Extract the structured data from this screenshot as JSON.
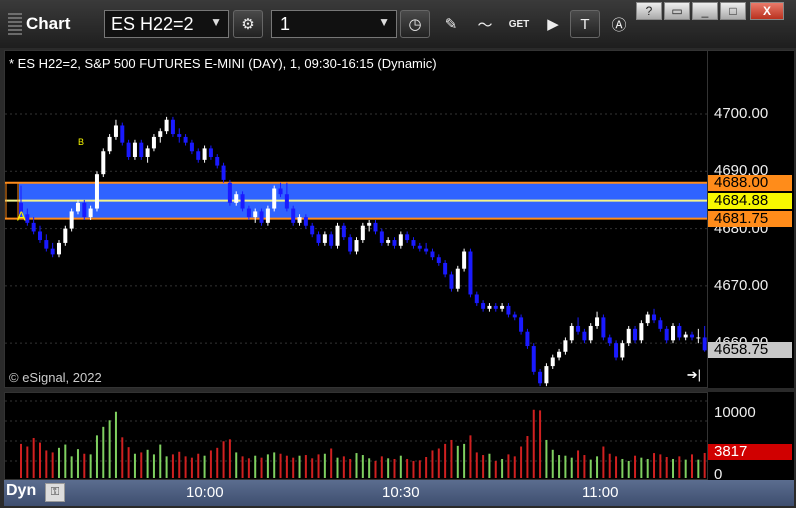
{
  "toolbar": {
    "app_title": "Chart",
    "symbol": "ES H22=2",
    "interval": "1",
    "get_label": "GET"
  },
  "window_buttons": [
    "?",
    "",
    "",
    "X"
  ],
  "chart": {
    "caption": "* ES H22=2, S&P 500 FUTURES E-MINI (DAY), 1, 09:30-16:15 (Dynamic)",
    "copyright": "© eSignal, 2022",
    "marker_a": "A",
    "marker_b": "B",
    "price_ticks": [
      "4700.00",
      "4690.00",
      "4680.00",
      "4670.00",
      "4660.00"
    ],
    "price_labels": {
      "upper": "4688.00",
      "mid": "4684.88",
      "lower": "4681.75",
      "last": "4658.75"
    },
    "volume_ticks": [
      "10000",
      "0"
    ],
    "volume_label": "3817",
    "time_labels": [
      "10:00",
      "10:30",
      "11:00"
    ],
    "dyn_label": "Dyn",
    "colors": {
      "up": "#ffffff",
      "down": "#1a1aff",
      "band": "#2f63ff",
      "band_edge": "#ff8c1a",
      "mid_line": "#f4f48a",
      "vol_up": "#7fd060",
      "vol_down": "#d02020"
    }
  },
  "chart_data": {
    "type": "candlestick",
    "bars": [
      [
        4684.5,
        4687.5,
        4682.0,
        4682.5
      ],
      [
        4682.5,
        4683.5,
        4680.5,
        4681.0
      ],
      [
        4681.0,
        4682.0,
        4679.0,
        4679.5
      ],
      [
        4679.5,
        4680.5,
        4677.5,
        4678.0
      ],
      [
        4678.0,
        4679.0,
        4676.0,
        4676.5
      ],
      [
        4676.5,
        4677.5,
        4675.0,
        4675.5
      ],
      [
        4675.5,
        4678.0,
        4675.0,
        4677.5
      ],
      [
        4677.5,
        4680.5,
        4677.0,
        4680.0
      ],
      [
        4680.0,
        4683.5,
        4679.5,
        4683.0
      ],
      [
        4683.0,
        4685.0,
        4682.5,
        4684.5
      ],
      [
        4684.5,
        4685.0,
        4681.5,
        4682.0
      ],
      [
        4682.0,
        4684.0,
        4681.5,
        4683.5
      ],
      [
        4683.5,
        4690.0,
        4683.0,
        4689.5
      ],
      [
        4689.5,
        4694.0,
        4689.0,
        4693.5
      ],
      [
        4693.5,
        4696.5,
        4693.0,
        4696.0
      ],
      [
        4696.0,
        4699.0,
        4695.5,
        4698.0
      ],
      [
        4698.0,
        4698.5,
        4694.5,
        4695.0
      ],
      [
        4695.0,
        4695.5,
        4692.0,
        4692.5
      ],
      [
        4692.5,
        4695.5,
        4692.0,
        4695.0
      ],
      [
        4695.0,
        4695.5,
        4692.0,
        4692.5
      ],
      [
        4692.5,
        4694.5,
        4691.5,
        4694.0
      ],
      [
        4694.0,
        4696.5,
        4693.5,
        4696.0
      ],
      [
        4696.0,
        4697.5,
        4695.0,
        4697.0
      ],
      [
        4697.0,
        4699.5,
        4696.5,
        4699.0
      ],
      [
        4699.0,
        4699.5,
        4696.0,
        4696.5
      ],
      [
        4696.5,
        4697.5,
        4695.0,
        4696.0
      ],
      [
        4696.0,
        4696.5,
        4694.5,
        4695.0
      ],
      [
        4695.0,
        4695.5,
        4693.0,
        4693.5
      ],
      [
        4693.5,
        4694.0,
        4691.5,
        4692.0
      ],
      [
        4692.0,
        4694.5,
        4691.5,
        4694.0
      ],
      [
        4694.0,
        4694.5,
        4692.0,
        4692.5
      ],
      [
        4692.5,
        4693.0,
        4690.5,
        4691.0
      ],
      [
        4691.0,
        4691.5,
        4688.0,
        4688.5
      ],
      [
        4688.0,
        4688.5,
        4684.0,
        4684.5
      ],
      [
        4684.5,
        4686.5,
        4684.0,
        4686.0
      ],
      [
        4686.0,
        4686.5,
        4683.0,
        4683.5
      ],
      [
        4683.5,
        4684.0,
        4681.5,
        4682.0
      ],
      [
        4682.0,
        4683.5,
        4681.0,
        4683.0
      ],
      [
        4683.0,
        4683.5,
        4680.5,
        4681.0
      ],
      [
        4681.0,
        4684.0,
        4680.5,
        4683.5
      ],
      [
        4683.5,
        4687.5,
        4683.0,
        4687.0
      ],
      [
        4687.0,
        4688.0,
        4685.5,
        4686.0
      ],
      [
        4686.0,
        4688.0,
        4683.0,
        4683.5
      ],
      [
        4683.5,
        4684.0,
        4680.5,
        4681.0
      ],
      [
        4681.0,
        4682.5,
        4680.5,
        4682.0
      ],
      [
        4682.0,
        4682.5,
        4680.0,
        4680.5
      ],
      [
        4680.5,
        4681.0,
        4678.5,
        4679.0
      ],
      [
        4679.0,
        4679.5,
        4677.0,
        4677.5
      ],
      [
        4677.5,
        4679.5,
        4677.0,
        4679.0
      ],
      [
        4679.0,
        4679.5,
        4676.5,
        4677.0
      ],
      [
        4677.0,
        4681.0,
        4676.5,
        4680.5
      ],
      [
        4680.5,
        4681.0,
        4678.0,
        4678.5
      ],
      [
        4678.5,
        4679.0,
        4675.5,
        4676.0
      ],
      [
        4676.0,
        4678.5,
        4675.5,
        4678.0
      ],
      [
        4678.0,
        4681.0,
        4677.5,
        4680.5
      ],
      [
        4680.5,
        4681.5,
        4679.5,
        4681.0
      ],
      [
        4681.0,
        4681.5,
        4679.0,
        4679.5
      ],
      [
        4679.5,
        4680.0,
        4677.0,
        4677.5
      ],
      [
        4677.5,
        4678.5,
        4677.0,
        4678.0
      ],
      [
        4678.0,
        4678.5,
        4676.5,
        4677.0
      ],
      [
        4677.0,
        4679.5,
        4676.5,
        4679.0
      ],
      [
        4679.0,
        4679.5,
        4677.5,
        4678.0
      ],
      [
        4678.0,
        4678.5,
        4676.5,
        4677.0
      ],
      [
        4677.0,
        4677.5,
        4676.0,
        4676.5
      ],
      [
        4676.5,
        4677.5,
        4675.5,
        4676.0
      ],
      [
        4676.0,
        4676.5,
        4674.5,
        4675.0
      ],
      [
        4675.0,
        4675.5,
        4673.5,
        4674.0
      ],
      [
        4674.0,
        4674.5,
        4671.5,
        4672.0
      ],
      [
        4672.0,
        4672.5,
        4669.0,
        4669.5
      ],
      [
        4669.5,
        4673.5,
        4669.0,
        4673.0
      ],
      [
        4673.0,
        4676.5,
        4672.5,
        4676.0
      ],
      [
        4676.0,
        4676.5,
        4668.0,
        4668.5
      ],
      [
        4668.5,
        4669.0,
        4666.5,
        4667.0
      ],
      [
        4667.0,
        4667.5,
        4665.5,
        4666.0
      ],
      [
        4666.0,
        4667.0,
        4665.5,
        4666.5
      ],
      [
        4666.5,
        4667.0,
        4665.5,
        4666.0
      ],
      [
        4666.0,
        4667.0,
        4665.5,
        4666.5
      ],
      [
        4666.5,
        4667.0,
        4664.5,
        4665.0
      ],
      [
        4665.0,
        4665.5,
        4664.0,
        4664.5
      ],
      [
        4664.5,
        4665.0,
        4661.5,
        4662.0
      ],
      [
        4662.0,
        4662.5,
        4659.0,
        4659.5
      ],
      [
        4659.5,
        4660.0,
        4654.5,
        4655.0
      ],
      [
        4655.0,
        4655.5,
        4652.5,
        4653.0
      ],
      [
        4653.0,
        4656.5,
        4652.5,
        4656.0
      ],
      [
        4656.0,
        4658.0,
        4655.5,
        4657.5
      ],
      [
        4657.5,
        4659.0,
        4657.0,
        4658.5
      ],
      [
        4658.5,
        4661.0,
        4658.0,
        4660.5
      ],
      [
        4660.5,
        4663.5,
        4660.0,
        4663.0
      ],
      [
        4663.0,
        4664.5,
        4661.5,
        4662.0
      ],
      [
        4662.0,
        4662.5,
        4660.0,
        4660.5
      ],
      [
        4660.5,
        4663.5,
        4660.0,
        4663.0
      ],
      [
        4663.0,
        4665.5,
        4662.5,
        4664.5
      ],
      [
        4664.5,
        4665.0,
        4660.5,
        4661.0
      ],
      [
        4661.0,
        4661.5,
        4659.5,
        4660.0
      ],
      [
        4660.0,
        4660.5,
        4657.0,
        4657.5
      ],
      [
        4657.5,
        4660.5,
        4657.0,
        4660.0
      ],
      [
        4660.0,
        4663.0,
        4659.5,
        4662.5
      ],
      [
        4662.5,
        4663.0,
        4660.0,
        4660.5
      ],
      [
        4660.5,
        4664.0,
        4660.0,
        4663.5
      ],
      [
        4663.5,
        4665.5,
        4663.0,
        4665.0
      ],
      [
        4665.0,
        4666.0,
        4663.5,
        4664.0
      ],
      [
        4664.0,
        4664.5,
        4662.0,
        4662.5
      ],
      [
        4662.5,
        4663.0,
        4660.0,
        4660.5
      ],
      [
        4660.5,
        4663.5,
        4660.0,
        4663.0
      ],
      [
        4663.0,
        4663.5,
        4660.5,
        4661.0
      ],
      [
        4661.0,
        4662.0,
        4660.5,
        4661.5
      ],
      [
        4661.5,
        4662.0,
        4660.5,
        4661.0
      ],
      [
        4661.0,
        4662.5,
        4660.0,
        4661.0
      ],
      [
        4661.0,
        4663.0,
        4658.5,
        4658.75
      ]
    ],
    "volume": [
      5200,
      4800,
      6100,
      5400,
      4200,
      3900,
      4600,
      5100,
      3300,
      4400,
      3700,
      3600,
      6500,
      7800,
      8800,
      10100,
      6200,
      4700,
      3700,
      3900,
      4300,
      3600,
      5100,
      3300,
      3600,
      4000,
      3300,
      3100,
      3700,
      3400,
      4200,
      4600,
      5600,
      5900,
      3900,
      3300,
      3000,
      3400,
      3100,
      3600,
      3900,
      3700,
      3400,
      3100,
      3400,
      3500,
      3000,
      3600,
      3700,
      4500,
      3100,
      3300,
      2900,
      3800,
      3500,
      3000,
      2600,
      3300,
      3000,
      2900,
      3400,
      2900,
      2600,
      2700,
      3200,
      4200,
      4500,
      5200,
      5800,
      4900,
      5200,
      6500,
      3900,
      3500,
      3700,
      2600,
      2900,
      3600,
      3300,
      4800,
      6400,
      10400,
      10300,
      5800,
      4300,
      3500,
      3400,
      3100,
      4200,
      3500,
      2800,
      3300,
      4800,
      3700,
      3300,
      2900,
      2600,
      3400,
      3100,
      2900,
      3800,
      3600,
      3200,
      2900,
      3300,
      2800,
      3600,
      2800,
      3817
    ],
    "ylim": [
      4652,
      4711
    ],
    "y_ticks": [
      4700,
      4690,
      4680,
      4670,
      4660
    ],
    "band": {
      "upper": 4688.0,
      "mid": 4684.88,
      "lower": 4681.75
    },
    "last": 4658.75,
    "volume_ylim": [
      0,
      12500
    ]
  }
}
